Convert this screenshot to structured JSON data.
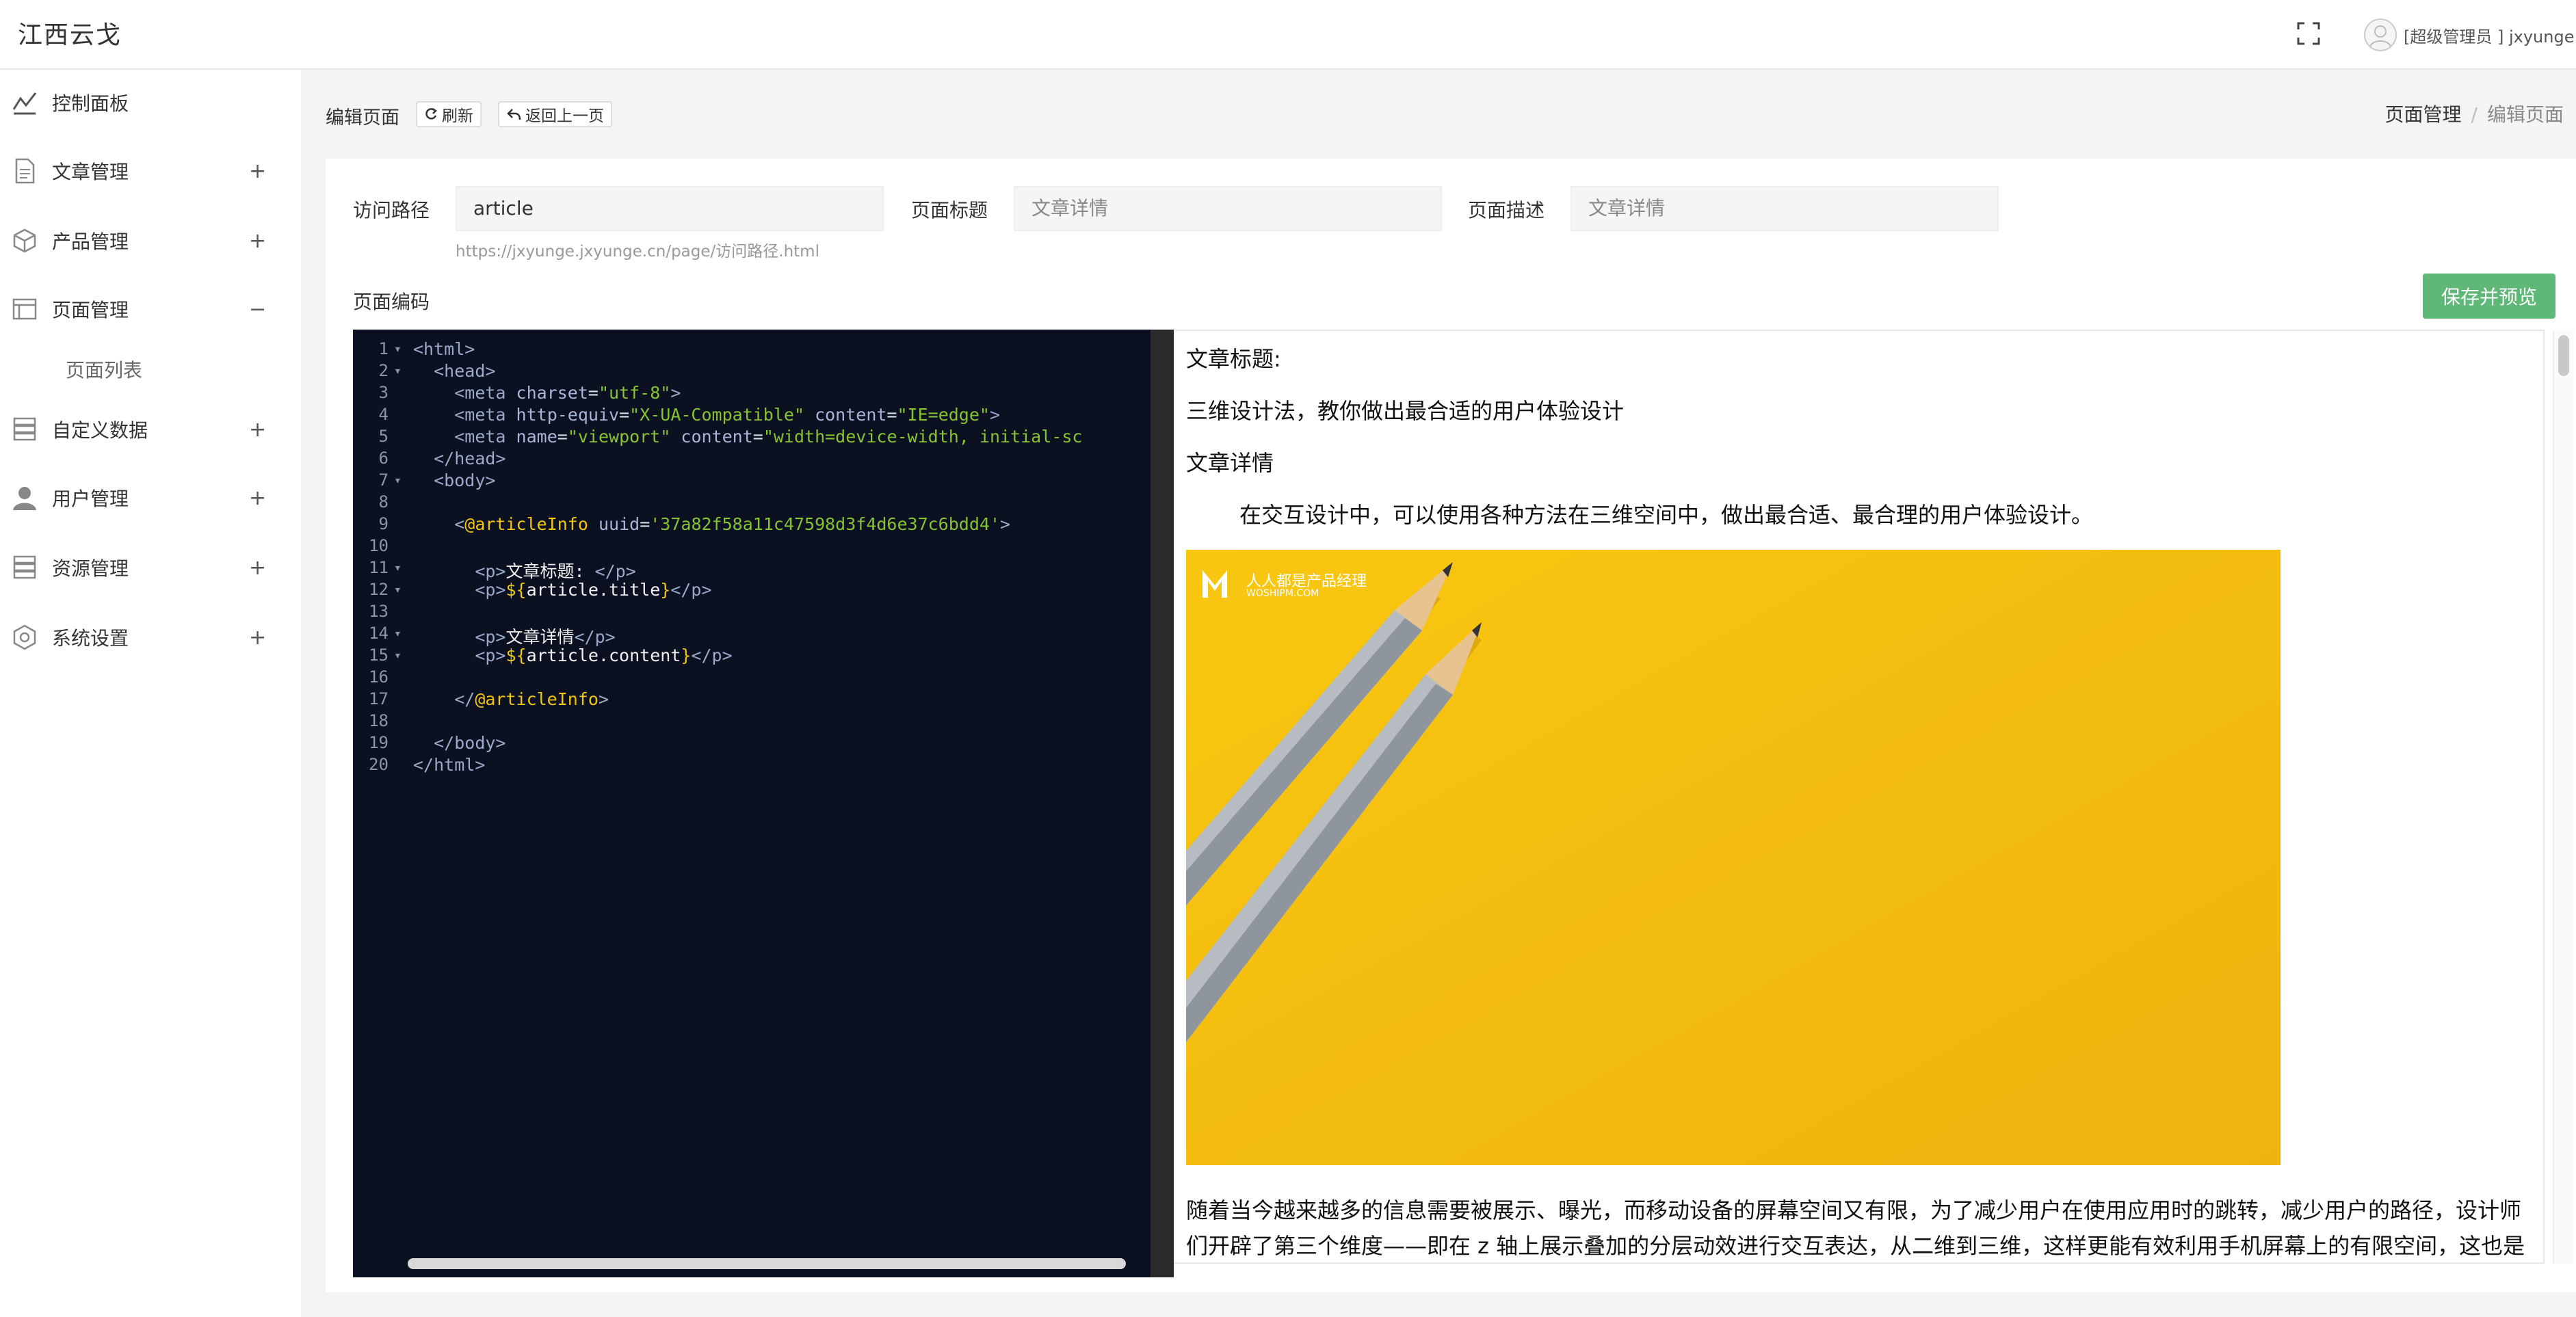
{
  "app": {
    "title": "江西云戈"
  },
  "user": {
    "label": "[超级管理员 ] jxyunge"
  },
  "sidebar": {
    "items": [
      {
        "label": "控制面板",
        "toggle": ""
      },
      {
        "label": "文章管理",
        "toggle": "+"
      },
      {
        "label": "产品管理",
        "toggle": "+"
      },
      {
        "label": "页面管理",
        "toggle": "−"
      },
      {
        "label": "页面列表",
        "toggle": ""
      },
      {
        "label": "自定义数据",
        "toggle": "+"
      },
      {
        "label": "用户管理",
        "toggle": "+"
      },
      {
        "label": "资源管理",
        "toggle": "+"
      },
      {
        "label": "系统设置",
        "toggle": "+"
      }
    ]
  },
  "header": {
    "page_name": "编辑页面",
    "refresh_label": "刷新",
    "back_label": "返回上一页",
    "breadcrumb": {
      "parent": "页面管理",
      "sep": "/",
      "current": "编辑页面"
    }
  },
  "form": {
    "path_label": "访问路径",
    "path_value": "article",
    "path_hint": "https://jxyunge.jxyunge.cn/page/访问路径.html",
    "title_label": "页面标题",
    "title_value": "文章详情",
    "desc_label": "页面描述",
    "desc_value": "文章详情",
    "code_label": "页面编码",
    "save_label": "保存并预览"
  },
  "editor": {
    "lines": [
      {
        "n": "1",
        "fold": true,
        "html": "<span class='tg'>&lt;html&gt;</span>"
      },
      {
        "n": "2",
        "fold": true,
        "html": "  <span class='tg'>&lt;head&gt;</span>"
      },
      {
        "n": "3",
        "fold": false,
        "html": "    <span class='tg'>&lt;meta</span> <span class='at'>charset</span>=<span class='st'>\"utf-8\"</span><span class='tg'>&gt;</span>"
      },
      {
        "n": "4",
        "fold": false,
        "html": "    <span class='tg'>&lt;meta</span> <span class='at'>http-equiv</span>=<span class='st'>\"X-UA-Compatible\"</span> <span class='at'>content</span>=<span class='st'>\"IE=edge\"</span><span class='tg'>&gt;</span>"
      },
      {
        "n": "5",
        "fold": false,
        "html": "    <span class='tg'>&lt;meta</span> <span class='at'>name</span>=<span class='st'>\"viewport\"</span> <span class='at'>content</span>=<span class='st'>\"width=device-width, initial-sc</span>"
      },
      {
        "n": "6",
        "fold": false,
        "html": "  <span class='tg'>&lt;/head&gt;</span>"
      },
      {
        "n": "7",
        "fold": true,
        "html": "  <span class='tg'>&lt;body&gt;</span>"
      },
      {
        "n": "8",
        "fold": false,
        "html": ""
      },
      {
        "n": "9",
        "fold": false,
        "html": "    <span class='tg'>&lt;</span><span class='kw'>@articleInfo</span> <span class='at'>uuid</span>=<span class='st'>'37a82f58a11c47598d3f4d6e37c6bdd4'</span><span class='tg'>&gt;</span>"
      },
      {
        "n": "10",
        "fold": false,
        "html": ""
      },
      {
        "n": "11",
        "fold": true,
        "html": "      <span class='tg'>&lt;p&gt;</span><span class='tx'>文章标题: </span><span class='tg'>&lt;/p&gt;</span>"
      },
      {
        "n": "12",
        "fold": true,
        "html": "      <span class='tg'>&lt;p&gt;</span><span class='kw'>${</span><span class='tx'>article.title</span><span class='kw'>}</span><span class='tg'>&lt;/p&gt;</span>"
      },
      {
        "n": "13",
        "fold": false,
        "html": ""
      },
      {
        "n": "14",
        "fold": true,
        "html": "      <span class='tg'>&lt;p&gt;</span><span class='tx'>文章详情</span><span class='tg'>&lt;/p&gt;</span>"
      },
      {
        "n": "15",
        "fold": true,
        "html": "      <span class='tg'>&lt;p&gt;</span><span class='kw'>${</span><span class='tx'>article.content</span><span class='kw'>}</span><span class='tg'>&lt;/p&gt;</span>"
      },
      {
        "n": "16",
        "fold": false,
        "html": ""
      },
      {
        "n": "17",
        "fold": false,
        "html": "    <span class='tg'>&lt;/</span><span class='kw'>@articleInfo</span><span class='tg'>&gt;</span>"
      },
      {
        "n": "18",
        "fold": false,
        "html": ""
      },
      {
        "n": "19",
        "fold": false,
        "html": "  <span class='tg'>&lt;/body&gt;</span>"
      },
      {
        "n": "20",
        "fold": false,
        "html": "<span class='tg'>&lt;/html&gt;</span>"
      }
    ]
  },
  "preview": {
    "title_label": "文章标题:",
    "title": "三维设计法，教你做出最合适的用户体验设计",
    "detail_label": "文章详情",
    "intro": "在交互设计中，可以使用各种方法在三维空间中，做出最合适、最合理的用户体验设计。",
    "watermark": "人人都是产品经理",
    "watermark_sub": "WOSHIPM.COM",
    "body": "随着当今越来越多的信息需要被展示、曝光，而移动设备的屏幕空间又有限，为了减少用户在使用应用时的跳转，减少用户的路径，设计师们开辟了第三个维度——即在 z 轴上展示叠加的分层动效进行交互表达，从二维到三维，这样更能有效利用手机屏幕上的有限空间，这也是以后界面设计的大趋势。"
  },
  "colors": {
    "save_button": "#5fb878",
    "editor_bg": "#0b1120",
    "image_bg": "#f7bf12"
  }
}
